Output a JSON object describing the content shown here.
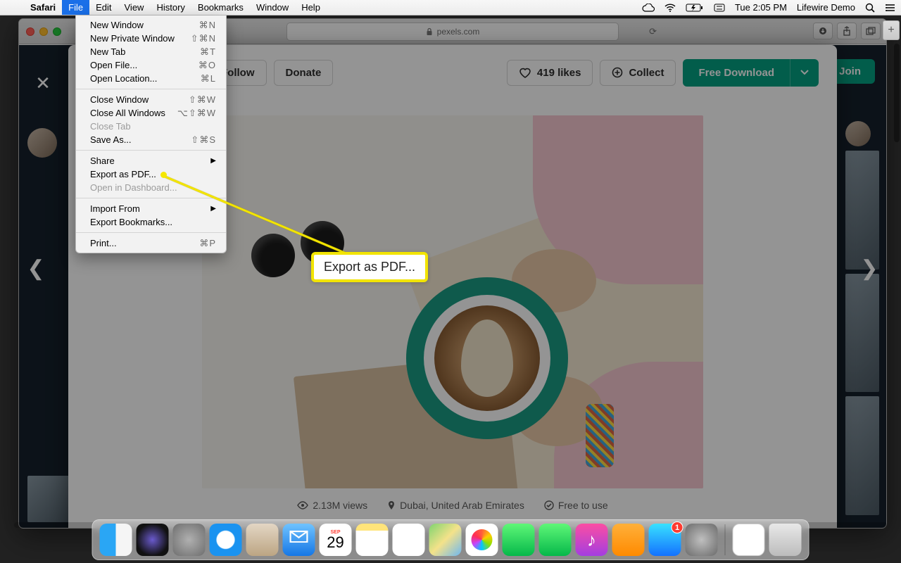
{
  "menubar": {
    "app": "Safari",
    "items": [
      "File",
      "Edit",
      "View",
      "History",
      "Bookmarks",
      "Window",
      "Help"
    ],
    "active_index": 0,
    "clock": "Tue 2:05 PM",
    "user": "Lifewire Demo"
  },
  "dropdown": {
    "items": [
      {
        "label": "New Window",
        "shortcut": "⌘N"
      },
      {
        "label": "New Private Window",
        "shortcut": "⇧⌘N"
      },
      {
        "label": "New Tab",
        "shortcut": "⌘T"
      },
      {
        "label": "Open File...",
        "shortcut": "⌘O"
      },
      {
        "label": "Open Location...",
        "shortcut": "⌘L"
      },
      {
        "sep": true
      },
      {
        "label": "Close Window",
        "shortcut": "⇧⌘W"
      },
      {
        "label": "Close All Windows",
        "shortcut": "⌥⇧⌘W"
      },
      {
        "label": "Close Tab",
        "shortcut": "",
        "disabled": true
      },
      {
        "label": "Save As...",
        "shortcut": "⇧⌘S"
      },
      {
        "sep": true
      },
      {
        "label": "Share",
        "submenu": true
      },
      {
        "label": "Export as PDF..."
      },
      {
        "label": "Open in Dashboard...",
        "disabled": true
      },
      {
        "sep": true
      },
      {
        "label": "Import From",
        "submenu": true
      },
      {
        "label": "Export Bookmarks..."
      },
      {
        "sep": true
      },
      {
        "label": "Print...",
        "shortcut": "⌘P"
      }
    ]
  },
  "browser": {
    "url_host": "pexels.com",
    "toolbar": {
      "follow": "Follow",
      "donate": "Donate",
      "likes": "419 likes",
      "collect": "Collect",
      "download": "Free Download"
    },
    "meta": {
      "views": "2.13M views",
      "location": "Dubai, United Arab Emirates",
      "license": "Free to use"
    },
    "header": {
      "join": "Join"
    }
  },
  "callout": {
    "text": "Export as PDF..."
  },
  "dock": {
    "items": [
      "finder",
      "siri",
      "launchpad",
      "safari",
      "contacts",
      "mail",
      "calendar",
      "notes",
      "reminders",
      "maps",
      "photos",
      "messages",
      "facetime",
      "music",
      "books",
      "appstore",
      "settings"
    ],
    "calendar_day": "29",
    "calendar_month": "SEP",
    "badge_count": "1",
    "extras": [
      "preview-doc",
      "trash"
    ]
  },
  "colors": {
    "accent": "#05a081",
    "menu_sel": "#1a6fe8",
    "callout": "#f2e400"
  }
}
